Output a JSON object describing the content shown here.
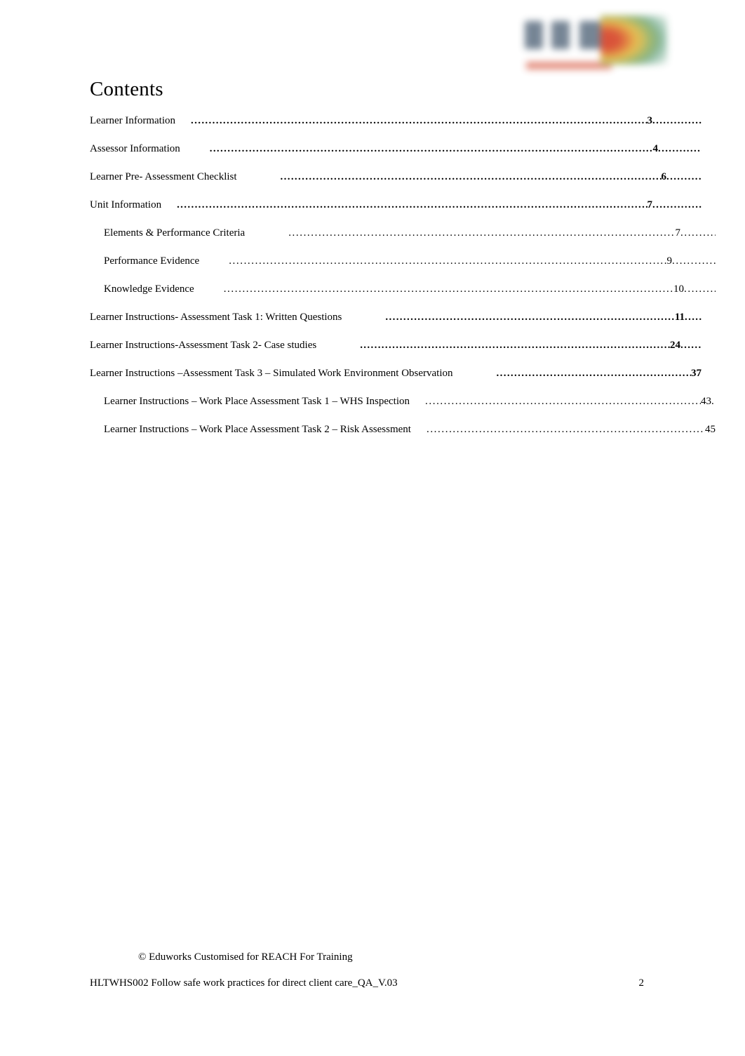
{
  "document": {
    "heading": "Contents",
    "logo_alt": "reach-for-training-logo"
  },
  "toc": {
    "entries": [
      {
        "title": "Learner Information",
        "page": "3",
        "level": "top",
        "bold": true,
        "gap": "sm",
        "tail": "w-70"
      },
      {
        "title": "Assessor Information",
        "page": "4",
        "level": "top",
        "bold": true,
        "gap": "md",
        "tail": "w-62"
      },
      {
        "title": "Learner Pre- Assessment Checklist",
        "page": "6",
        "level": "top",
        "bold": true,
        "gap": "lg",
        "tail": "w-50"
      },
      {
        "title": "Unit Information",
        "page": "7",
        "level": "top",
        "bold": true,
        "gap": "sm",
        "tail": "w-70"
      },
      {
        "title": "Elements & Performance Criteria",
        "page": "7",
        "level": "sub",
        "bold": false,
        "gap": "lg",
        "tail": "w-50"
      },
      {
        "title": "Performance Evidence",
        "page": "9",
        "level": "sub",
        "bold": false,
        "gap": "md",
        "tail": "w-62"
      },
      {
        "title": "Knowledge Evidence",
        "page": "10",
        "level": "sub",
        "bold": false,
        "gap": "md",
        "tail": "w-45"
      },
      {
        "title": "Learner Instructions- Assessment Task 1: Written Questions",
        "page": "11",
        "level": "top",
        "bold": true,
        "gap": "lg",
        "tail": "w-24"
      },
      {
        "title": "Learner Instructions-Assessment Task 2- Case studies",
        "page": "24",
        "level": "top",
        "bold": true,
        "gap": "lg",
        "tail": "w-30"
      },
      {
        "title": "Learner Instructions      –Assessment Task 3     – Simulated Work Environment Observation",
        "page": "37",
        "level": "top",
        "bold": true,
        "gap": "lg",
        "tail": "w-0"
      },
      {
        "title": "Learner Instructions     – Work Place Assessment Task 1      – WHS Inspection",
        "page": "43",
        "level": "sub",
        "bold": false,
        "gap": "sm",
        "tail": "w-6"
      },
      {
        "title": "Learner Instructions     – Work Place Assessment Task 2      – Risk Assessment",
        "page": "45",
        "level": "sub",
        "bold": false,
        "gap": "sm",
        "tail": "w-0"
      }
    ]
  },
  "footer": {
    "credit": "© Eduworks Customised for REACH For Training",
    "document_id": "HLTWHS002 Follow safe work practices for direct client care_QA_V.03",
    "page_number": "2"
  }
}
